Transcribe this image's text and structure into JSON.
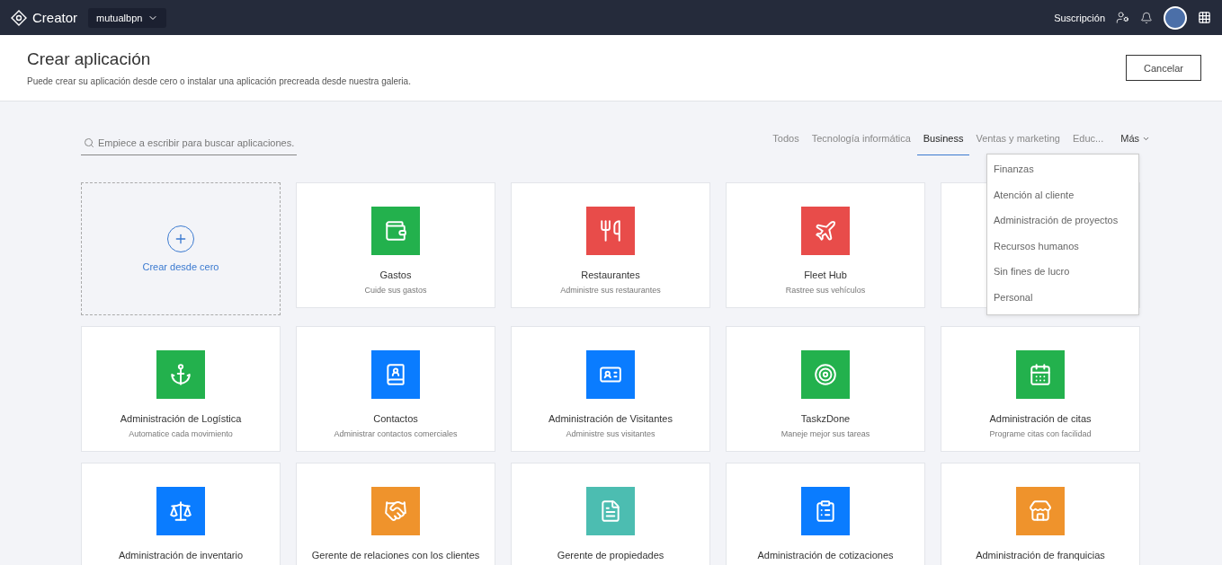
{
  "topbar": {
    "brand": "Creator",
    "workspace": "mutualbpn",
    "subscription": "Suscripción"
  },
  "header": {
    "title": "Crear aplicación",
    "subtitle": "Puede crear su aplicación desde cero o instalar una aplicación precreada desde nuestra galeria.",
    "cancel": "Cancelar"
  },
  "search": {
    "placeholder": "Empiece a escribir para buscar aplicaciones."
  },
  "tabs": [
    {
      "label": "Todos",
      "selected": false
    },
    {
      "label": "Tecnología informática",
      "selected": false
    },
    {
      "label": "Business",
      "selected": true
    },
    {
      "label": "Ventas y marketing",
      "selected": false
    },
    {
      "label": "Educ...",
      "selected": false
    }
  ],
  "more": {
    "label": "Más",
    "expanded": true,
    "items": [
      "Finanzas",
      "Atención al cliente",
      "Administración de proyectos",
      "Recursos humanos",
      "Sin fines de lucro",
      "Personal"
    ]
  },
  "create_card": {
    "label": "Crear desde cero"
  },
  "rows": [
    [
      {
        "title": "Gastos",
        "subtitle": "Cuide sus gastos",
        "color": "#23b14d"
      },
      {
        "title": "Restaurantes",
        "subtitle": "Administre sus restaurantes",
        "color": "#e84c4a"
      },
      {
        "title": "Fleet Hub",
        "subtitle": "Rastree sus vehículos",
        "color": "#e84c4a"
      }
    ],
    [
      {
        "title": "Administración de Logística",
        "subtitle": "Automatice cada movimiento",
        "color": "#23b14d"
      },
      {
        "title": "Contactos",
        "subtitle": "Administrar contactos comerciales",
        "color": "#0a7cff"
      },
      {
        "title": "Administración de Visitantes",
        "subtitle": "Administre sus visitantes",
        "color": "#0a7cff"
      },
      {
        "title": "TaskzDone",
        "subtitle": "Maneje mejor sus tareas",
        "color": "#23b14d"
      },
      {
        "title": "Administración de citas",
        "subtitle": "Programe citas con facilidad",
        "color": "#23b14d"
      }
    ],
    [
      {
        "title": "Administración de inventario",
        "color": "#0a7cff"
      },
      {
        "title": "Gerente de relaciones con los clientes",
        "color": "#ef932c"
      },
      {
        "title": "Gerente de propiedades",
        "color": "#4cbdb1"
      },
      {
        "title": "Administración de cotizaciones",
        "color": "#0a7cff"
      },
      {
        "title": "Administración de franquicias",
        "color": "#ef932c"
      }
    ]
  ]
}
